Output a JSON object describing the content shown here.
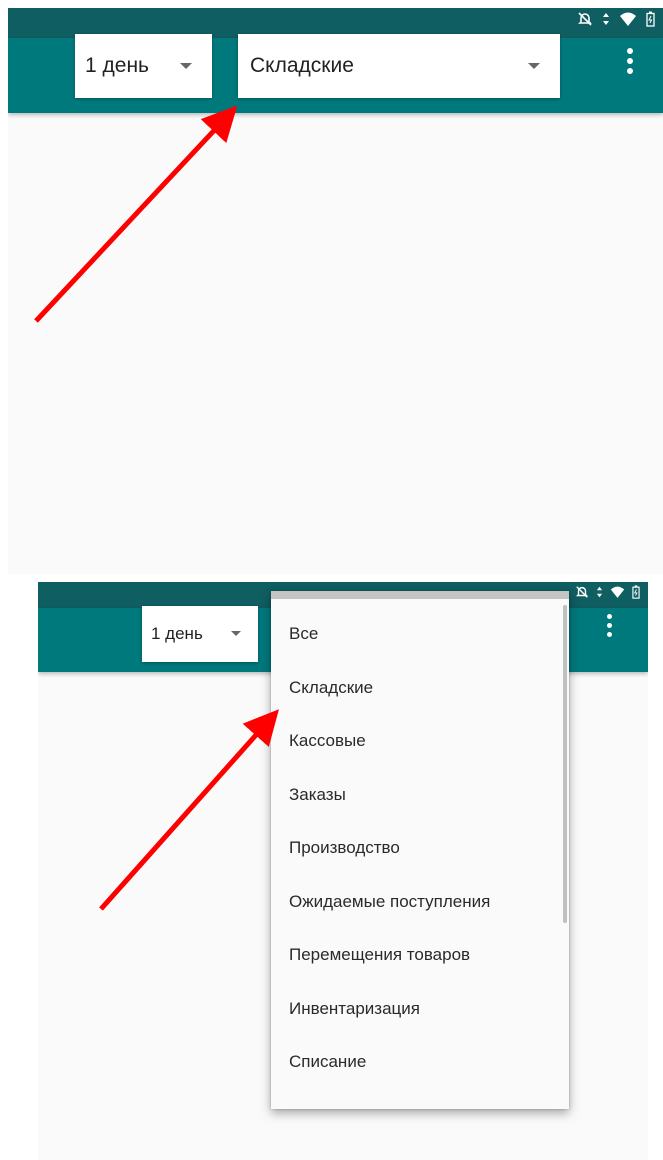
{
  "screens": [
    {
      "period_spinner": {
        "value": "1 день"
      },
      "type_spinner": {
        "value": "Складские"
      }
    },
    {
      "period_spinner": {
        "value": "1 день"
      },
      "dropdown": {
        "items": [
          "Все",
          "Складские",
          "Кассовые",
          "Заказы",
          "Производство",
          "Ожидаемые поступления",
          "Перемещения товаров",
          "Инвентаризация",
          "Списание"
        ]
      }
    }
  ],
  "colors": {
    "statusbar": "#0f5e62",
    "toolbar": "#00797d",
    "content_bg": "#fafafa",
    "annotation_arrow": "#ff0000"
  },
  "icons": {
    "status_bar": [
      "mute-icon",
      "data-transfer-icon",
      "wifi-icon",
      "battery-icon"
    ],
    "toolbar": [
      "overflow-menu-icon",
      "dropdown-caret-icon"
    ]
  }
}
